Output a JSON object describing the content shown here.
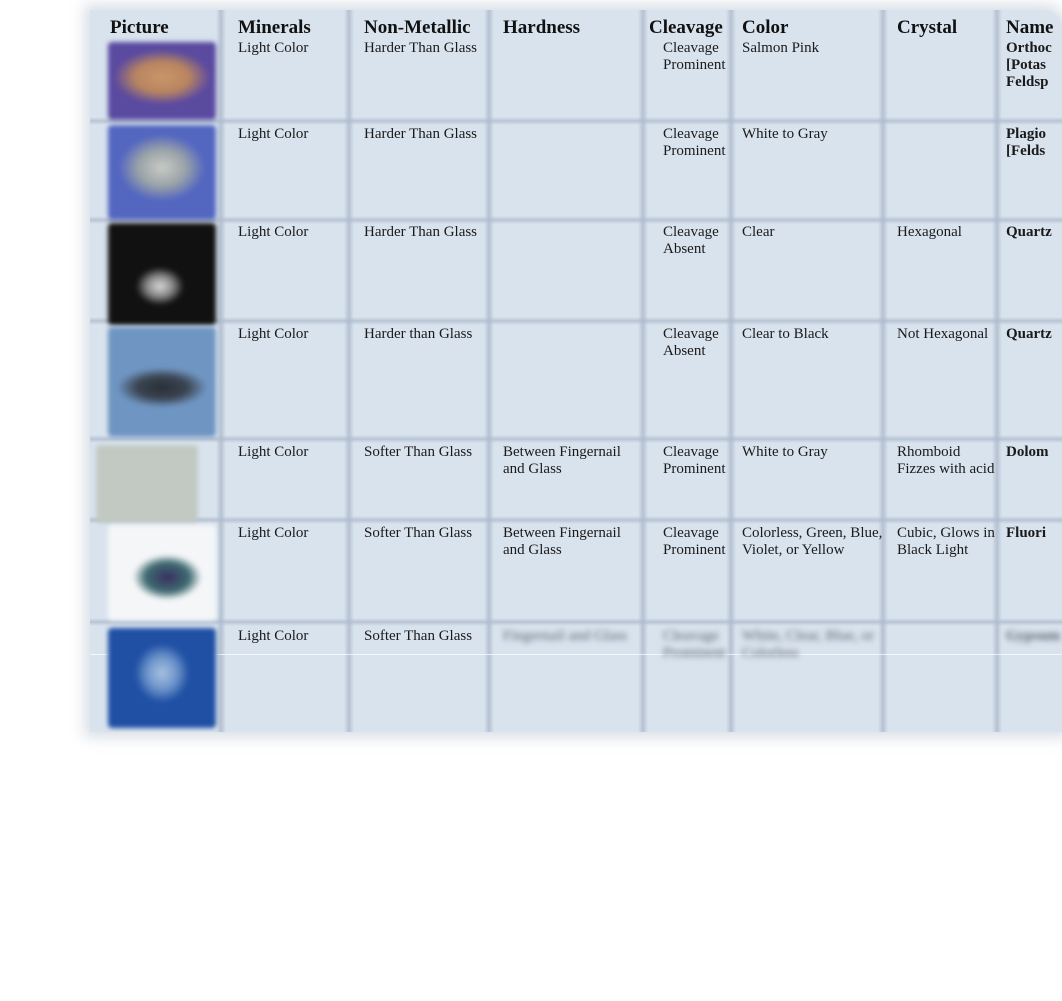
{
  "headers": [
    "Picture",
    "Minerals",
    "Non-Metallic",
    "Hardness",
    "Cleavage",
    "Color",
    "Crystal",
    "Name"
  ],
  "rows": [
    {
      "picture": "orthoclase-image",
      "minerals": "Light Color",
      "non_metallic": "Harder Than Glass",
      "hardness": "",
      "cleavage": "Cleavage\nProminent",
      "color": "Salmon Pink",
      "crystal": "",
      "name": "Orthoc\n[Potas\nFeldsp"
    },
    {
      "picture": "plagioclase-image",
      "minerals": "Light Color",
      "non_metallic": "Harder Than Glass",
      "hardness": "",
      "cleavage": "Cleavage\nProminent",
      "color": "White to Gray",
      "crystal": "",
      "name": "Plagio\n[Felds"
    },
    {
      "picture": "quartz-crystal-image",
      "minerals": "Light Color",
      "non_metallic": "Harder Than Glass",
      "hardness": "",
      "cleavage": "Cleavage\nAbsent",
      "color": "Clear",
      "crystal": "Hexagonal",
      "name": "Quartz"
    },
    {
      "picture": "quartz-massive-image",
      "minerals": "Light Color",
      "non_metallic": "Harder than  Glass",
      "hardness": "",
      "cleavage": "Cleavage\nAbsent",
      "color": "Clear to Black",
      "crystal": "Not Hexagonal",
      "name": "Quartz"
    },
    {
      "picture": "dolomite-image",
      "minerals": "Light Color",
      "non_metallic": "Softer Than Glass",
      "hardness": "Between Fingernail\nand Glass",
      "cleavage": "Cleavage\nProminent",
      "color": "White to Gray",
      "crystal": "Rhomboid\nFizzes  with acid",
      "name": "Dolom"
    },
    {
      "picture": "fluorite-image",
      "minerals": "Light Color",
      "non_metallic": "Softer Than Glass",
      "hardness": "Between Fingernail\nand Glass",
      "cleavage": "Cleavage\nProminent",
      "color": "Colorless, Green, Blue,\nViolet, or Yellow",
      "crystal": "Cubic, Glows in\nBlack Light",
      "name": "Fluori"
    },
    {
      "picture": "blurred-mineral-image",
      "minerals": "Light Color",
      "non_metallic": "Softer Than Glass",
      "hardness": "Fingernail and Glass",
      "cleavage": "Cleavage\nProminent",
      "color": "White, Clear, Blue, or\nColorless",
      "crystal": "",
      "name": "Gypsum"
    }
  ]
}
